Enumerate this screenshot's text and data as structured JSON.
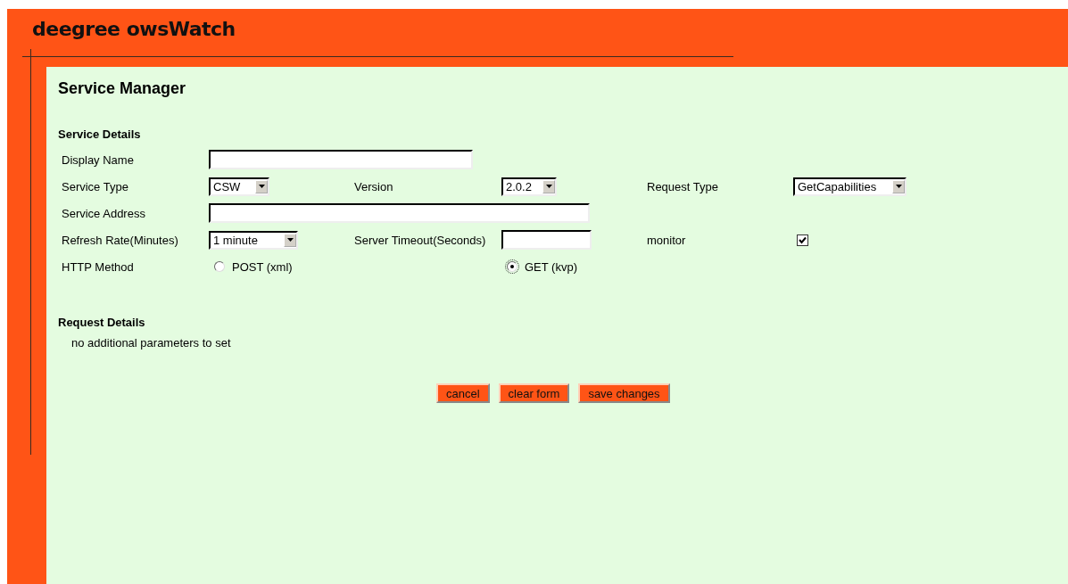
{
  "header": {
    "title": "deegree owsWatch"
  },
  "page_title": "Service Manager",
  "service_details": {
    "heading": "Service Details",
    "rows": [
      [
        {
          "kind": "label",
          "text": "Display Name"
        },
        {
          "kind": "text"
        }
      ],
      [
        {
          "kind": "label",
          "text": "Service Type"
        },
        {
          "kind": "select",
          "value": "CSW"
        },
        {
          "kind": "label",
          "text": "Version"
        },
        {
          "kind": "select",
          "value": "2.0.2"
        },
        {
          "kind": "label",
          "text": "Request Type"
        },
        {
          "kind": "select",
          "value": "GetCapabilities"
        }
      ],
      [
        {
          "kind": "label",
          "text": "Service Address"
        },
        {
          "kind": "text"
        }
      ],
      [
        {
          "kind": "label",
          "text": "Refresh Rate(Minutes)"
        },
        {
          "kind": "select",
          "value": "1 minute"
        },
        {
          "kind": "label",
          "text": "Server Timeout(Seconds)"
        },
        {
          "kind": "text"
        },
        {
          "kind": "label",
          "text": "monitor"
        },
        {
          "kind": "checkbox",
          "checked": true
        }
      ],
      [
        {
          "kind": "label",
          "text": "HTTP Method"
        },
        {
          "kind": "radio",
          "label": "POST (xml)",
          "selected": false
        },
        {
          "kind": "spacer"
        },
        {
          "kind": "radio",
          "label": "GET (kvp)",
          "selected": true
        }
      ]
    ]
  },
  "request_details": {
    "heading": "Request Details",
    "note": "no additional parameters to set"
  },
  "buttons": [
    "cancel",
    "clear form",
    "save changes"
  ]
}
